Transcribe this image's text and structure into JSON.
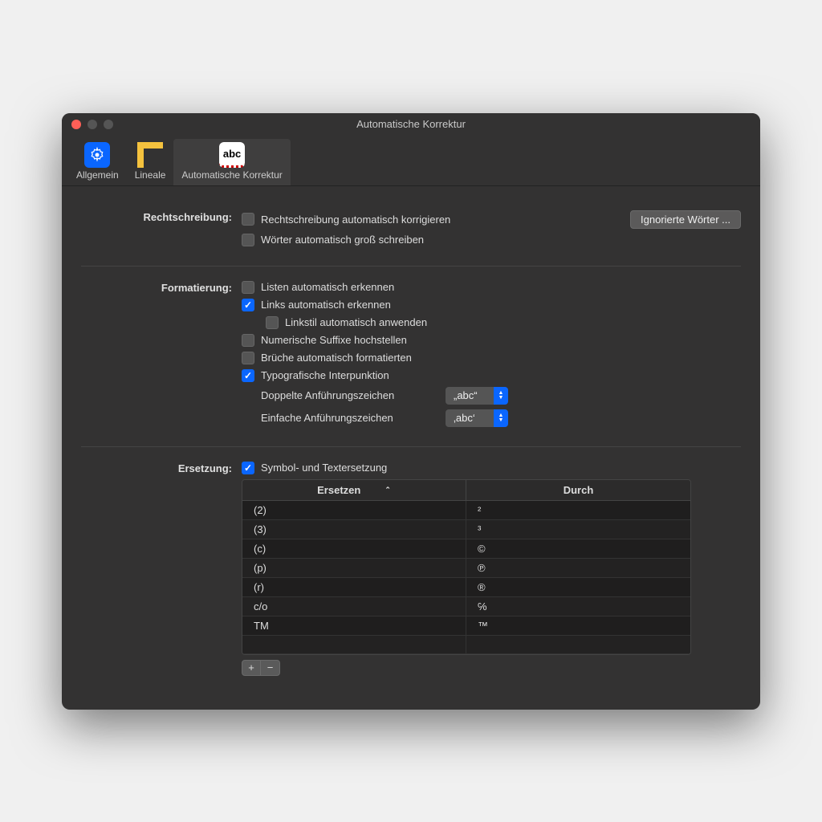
{
  "window": {
    "title": "Automatische Korrektur"
  },
  "toolbar": {
    "tabs": [
      {
        "label": "Allgemein"
      },
      {
        "label": "Lineale"
      },
      {
        "label": "Automatische Korrektur"
      }
    ]
  },
  "sections": {
    "spelling": {
      "heading": "Rechtschreibung:",
      "auto_correct": {
        "label": "Rechtschreibung automatisch korrigieren",
        "checked": false
      },
      "capitalize": {
        "label": "Wörter automatisch groß schreiben",
        "checked": false
      },
      "ignored_button": "Ignorierte Wörter ..."
    },
    "formatting": {
      "heading": "Formatierung:",
      "auto_lists": {
        "label": "Listen automatisch erkennen",
        "checked": false
      },
      "auto_links": {
        "label": "Links automatisch erkennen",
        "checked": true
      },
      "link_style": {
        "label": "Linkstil automatisch anwenden",
        "checked": false
      },
      "numeric_suffix": {
        "label": "Numerische Suffixe hochstellen",
        "checked": false
      },
      "fractions": {
        "label": "Brüche automatisch formatierten",
        "checked": false
      },
      "typographic": {
        "label": "Typografische Interpunktion",
        "checked": true
      },
      "double_quotes": {
        "label": "Doppelte Anführungszeichen",
        "value": "„abc“"
      },
      "single_quotes": {
        "label": "Einfache Anführungszeichen",
        "value": "‚abc‘"
      }
    },
    "replacement": {
      "heading": "Ersetzung:",
      "enable": {
        "label": "Symbol- und Textersetzung",
        "checked": true
      },
      "columns": {
        "replace": "Ersetzen",
        "with": "Durch"
      },
      "rows": [
        {
          "replace": "(2)",
          "with": "²"
        },
        {
          "replace": "(3)",
          "with": "³"
        },
        {
          "replace": "(c)",
          "with": "©"
        },
        {
          "replace": "(p)",
          "with": "℗"
        },
        {
          "replace": "(r)",
          "with": "®"
        },
        {
          "replace": "c/o",
          "with": "℅"
        },
        {
          "replace": "TM",
          "with": "™"
        }
      ],
      "add_button": "+",
      "remove_button": "−"
    }
  }
}
